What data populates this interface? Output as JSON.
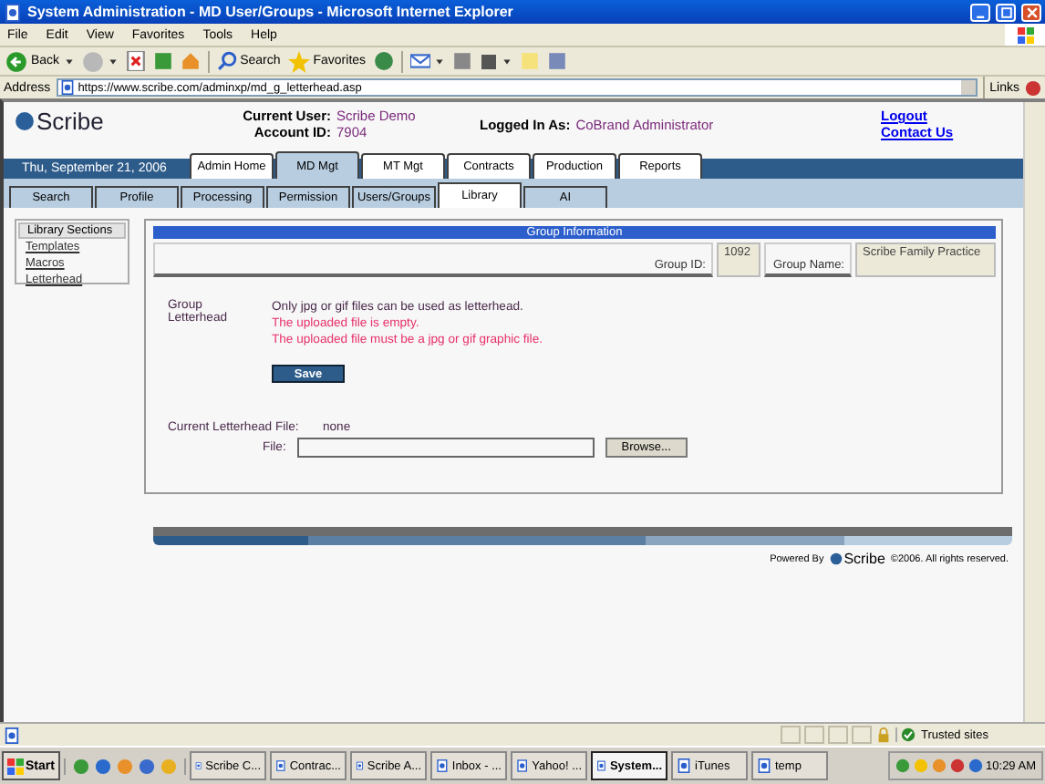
{
  "window": {
    "title": "System Administration - MD User/Groups - Microsoft Internet Explorer"
  },
  "menu": [
    "File",
    "Edit",
    "View",
    "Favorites",
    "Tools",
    "Help"
  ],
  "toolbar": {
    "back": "Back",
    "search": "Search",
    "favorites": "Favorites"
  },
  "address": {
    "label": "Address",
    "url": "https://www.scribe.com/adminxp/md_g_letterhead.asp",
    "links": "Links"
  },
  "header": {
    "logo": "Scribe",
    "current_user_label": "Current User:",
    "current_user": "Scribe Demo",
    "account_label": "Account ID:",
    "account": "7904",
    "logged_label": "Logged In As:",
    "logged": "CoBrand Administrator",
    "links": [
      "Logout",
      "Contact Us"
    ]
  },
  "date": "Thu, September 21, 2006",
  "tabs": [
    {
      "label": "Admin Home",
      "selected": false
    },
    {
      "label": "MD Mgt",
      "selected": true
    },
    {
      "label": "MT Mgt",
      "selected": false
    },
    {
      "label": "Contracts",
      "selected": false
    },
    {
      "label": "Production",
      "selected": false
    },
    {
      "label": "Reports",
      "selected": false
    }
  ],
  "subtabs": [
    {
      "label": "Search",
      "selected": false
    },
    {
      "label": "Profile",
      "selected": false
    },
    {
      "label": "Processing",
      "selected": false
    },
    {
      "label": "Permission",
      "selected": false
    },
    {
      "label": "Users/Groups",
      "selected": false
    },
    {
      "label": "Library",
      "selected": true
    },
    {
      "label": "AI",
      "selected": false
    }
  ],
  "sidebar": {
    "title": "Library Sections",
    "items": [
      "Templates",
      "Macros",
      "Letterhead"
    ]
  },
  "group_info": {
    "title": "Group Information",
    "id_label": "Group ID:",
    "id": "1092",
    "name_label": "Group Name:",
    "name": "Scribe Family Practice"
  },
  "form": {
    "label": "Group Letterhead",
    "note": "Only jpg or gif files can be used as letterhead.",
    "errors": [
      "The uploaded file is empty.",
      "The uploaded file must be a jpg or gif graphic file."
    ],
    "save": "Save",
    "current_label": "Current Letterhead File:",
    "current": "none",
    "file_label": "File:",
    "browse": "Browse..."
  },
  "footer": {
    "powered": "Powered By",
    "logo": "Scribe",
    "copyright": "©2006. All rights reserved."
  },
  "status": {
    "zone": "Trusted sites"
  },
  "taskbar": {
    "start": "Start",
    "tasks": [
      {
        "label": "Scribe C...",
        "selected": false
      },
      {
        "label": "Contrac...",
        "selected": false
      },
      {
        "label": "Scribe A...",
        "selected": false
      },
      {
        "label": "Inbox - ...",
        "selected": false
      },
      {
        "label": "Yahoo! ...",
        "selected": false
      },
      {
        "label": "System...",
        "selected": true
      },
      {
        "label": "iTunes",
        "selected": false
      },
      {
        "label": "temp",
        "selected": false
      }
    ],
    "clock": "10:29 AM"
  }
}
